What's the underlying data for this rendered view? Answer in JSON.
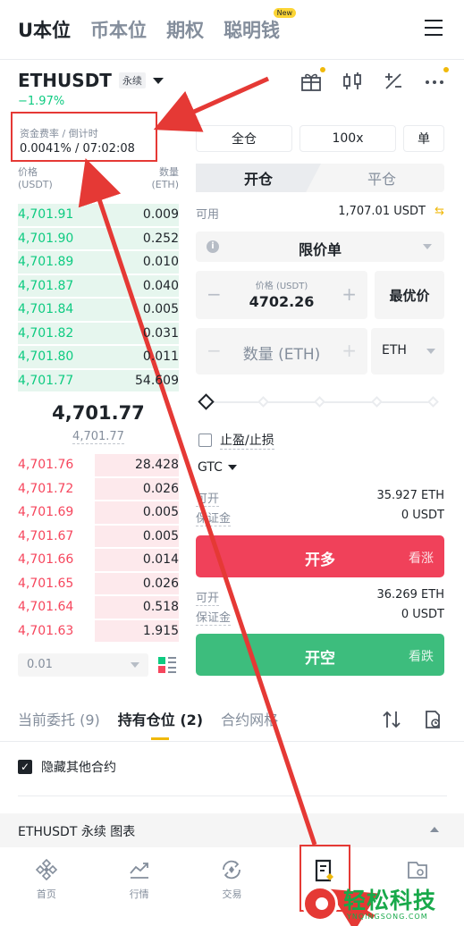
{
  "top_tabs": [
    {
      "label": "U本位",
      "active": true
    },
    {
      "label": "币本位",
      "active": false
    },
    {
      "label": "期权",
      "active": false
    },
    {
      "label": "聪明钱",
      "active": false,
      "badge": "New"
    }
  ],
  "header": {
    "symbol": "ETHUSDT",
    "contract_type": "永续",
    "change": "−1.97%"
  },
  "funding": {
    "label": "资金费率 / 倒计时",
    "value": "0.0041% / 07:02:08"
  },
  "orderbook": {
    "price_label": "价格",
    "price_unit": "(USDT)",
    "qty_label": "数量",
    "qty_unit": "(ETH)",
    "asks": [
      {
        "price": "4,701.91",
        "qty": "0.009",
        "depth": 1.0
      },
      {
        "price": "4,701.90",
        "qty": "0.252",
        "depth": 1.0
      },
      {
        "price": "4,701.89",
        "qty": "0.010",
        "depth": 1.0
      },
      {
        "price": "4,701.87",
        "qty": "0.040",
        "depth": 1.0
      },
      {
        "price": "4,701.84",
        "qty": "0.005",
        "depth": 1.0
      },
      {
        "price": "4,701.82",
        "qty": "0.031",
        "depth": 1.0
      },
      {
        "price": "4,701.80",
        "qty": "0.011",
        "depth": 1.0
      },
      {
        "price": "4,701.77",
        "qty": "54.609",
        "depth": 1.0
      }
    ],
    "mid_price": "4,701.77",
    "mark_price": "4,701.77",
    "bids": [
      {
        "price": "4,701.76",
        "qty": "28.428",
        "depth": 0.52
      },
      {
        "price": "4,701.72",
        "qty": "0.026",
        "depth": 0.52
      },
      {
        "price": "4,701.69",
        "qty": "0.005",
        "depth": 0.52
      },
      {
        "price": "4,701.67",
        "qty": "0.005",
        "depth": 0.52
      },
      {
        "price": "4,701.66",
        "qty": "0.014",
        "depth": 0.52
      },
      {
        "price": "4,701.65",
        "qty": "0.026",
        "depth": 0.52
      },
      {
        "price": "4,701.64",
        "qty": "0.518",
        "depth": 0.52
      },
      {
        "price": "4,701.63",
        "qty": "1.915",
        "depth": 0.52
      }
    ],
    "precision": "0.01"
  },
  "order_form": {
    "margin_mode": "全仓",
    "leverage": "100x",
    "position_mode": "单",
    "open_tab": "开仓",
    "close_tab": "平仓",
    "available_label": "可用",
    "available_value": "1,707.01 USDT",
    "order_type": "限价单",
    "price_sub": "价格 (USDT)",
    "price_value": "4702.26",
    "best_price": "最优价",
    "qty_placeholder": "数量 (ETH)",
    "qty_unit": "ETH",
    "tpsl_label": "止盈/止损",
    "tif": "GTC",
    "long": {
      "open_label": "可开",
      "open_value": "35.927 ETH",
      "margin_label": "保证金",
      "margin_value": "0 USDT",
      "button": "开多",
      "button_side": "看涨"
    },
    "short": {
      "open_label": "可开",
      "open_value": "36.269 ETH",
      "margin_label": "保证金",
      "margin_value": "0 USDT",
      "button": "开空",
      "button_side": "看跌"
    }
  },
  "positions": {
    "tabs": [
      {
        "label": "当前委托 (9)",
        "active": false
      },
      {
        "label": "持有仓位 (2)",
        "active": true
      },
      {
        "label": "合约网格",
        "active": false
      }
    ],
    "hide_other": "隐藏其他合约",
    "chart_bar": "ETHUSDT 永续  图表"
  },
  "bottom_nav": [
    {
      "label": "首页",
      "icon": "home-icon"
    },
    {
      "label": "行情",
      "icon": "markets-icon"
    },
    {
      "label": "交易",
      "icon": "trade-icon"
    },
    {
      "label": "",
      "icon": "futures-icon"
    },
    {
      "label": "",
      "icon": "wallet-icon"
    }
  ],
  "watermark": {
    "text": "轻松科技",
    "sub": "YNQINGSONG.COM"
  },
  "colors": {
    "green": "#0ecb81",
    "red": "#f6465d",
    "accent": "#f0b90b",
    "long_button": "#f0415a",
    "short_button": "#3dbd7d"
  }
}
